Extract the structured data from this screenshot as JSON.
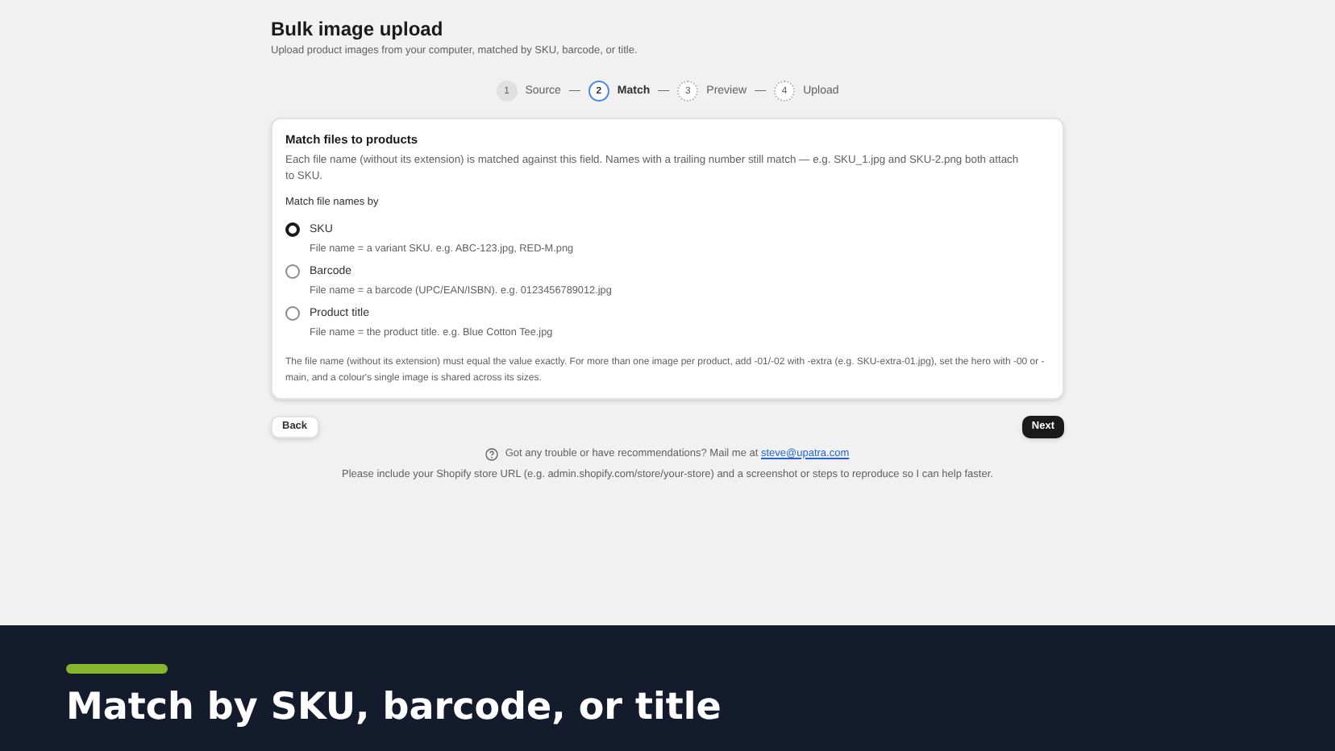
{
  "header": {
    "title": "Bulk image upload",
    "subtitle": "Upload product images from your computer, matched by SKU, barcode, or title."
  },
  "steps": [
    {
      "number": "1",
      "label": "Source",
      "selected": false,
      "completed": true
    },
    {
      "number": "2",
      "label": "Match",
      "selected": true,
      "completed": false
    },
    {
      "number": "3",
      "label": "Preview",
      "selected": false,
      "completed": false
    },
    {
      "number": "4",
      "label": "Upload",
      "selected": false,
      "completed": false
    }
  ],
  "step_separator": "—",
  "card": {
    "title": "Match files to products",
    "description": "Each file name (without its extension) is matched against this field. Names with a trailing number still match — e.g. SKU_1.jpg and SKU-2.png both attach to SKU.",
    "group_label": "Match file names by",
    "options": [
      {
        "label": "SKU",
        "help": "File name = a variant SKU. e.g. ABC-123.jpg, RED-M.png",
        "selected": true
      },
      {
        "label": "Barcode",
        "help": "File name = a barcode (UPC/EAN/ISBN). e.g. 0123456789012.jpg",
        "selected": false
      },
      {
        "label": "Product title",
        "help": "File name = the product title. e.g. Blue Cotton Tee.jpg",
        "selected": false
      }
    ],
    "note": "The file name (without its extension) must equal the value exactly. For more than one image per product, add -01/-02 with -extra (e.g. SKU-extra-01.jpg), set the hero with -00 or -main, and a colour's single image is shared across its sizes."
  },
  "buttons": {
    "back": "Back",
    "next": "Next"
  },
  "footer": {
    "help_text": "Got any trouble or have recommendations? Mail me at",
    "email": "steve@upatra.com",
    "note": "Please include your Shopify store URL (e.g. admin.shopify.com/store/your-store) and a screenshot or steps to reproduce so I can help faster."
  },
  "banner": {
    "title": "Match by SKU, barcode, or title"
  }
}
